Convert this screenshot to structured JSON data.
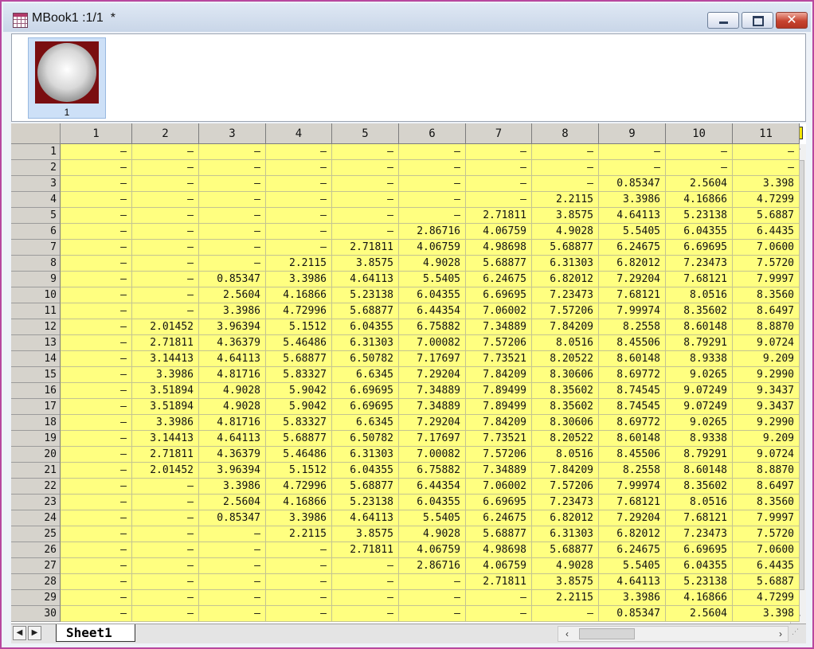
{
  "window": {
    "title": "MBook1 :1/1  *",
    "minimize_glyph": "",
    "maximize_glyph": "",
    "close_glyph": "✕"
  },
  "thumbnails": [
    {
      "label": "1",
      "image": "gray-sphere-on-dark-red"
    }
  ],
  "grid": {
    "columns": [
      "1",
      "2",
      "3",
      "4",
      "5",
      "6",
      "7",
      "8",
      "9",
      "10",
      "11"
    ],
    "rows": [
      {
        "label": "1",
        "cells": [
          "—",
          "—",
          "—",
          "—",
          "—",
          "—",
          "—",
          "—",
          "—",
          "—",
          "—"
        ]
      },
      {
        "label": "2",
        "cells": [
          "—",
          "—",
          "—",
          "—",
          "—",
          "—",
          "—",
          "—",
          "—",
          "—",
          "—"
        ]
      },
      {
        "label": "3",
        "cells": [
          "—",
          "—",
          "—",
          "—",
          "—",
          "—",
          "—",
          "—",
          "0.85347",
          "2.5604",
          "3.398"
        ]
      },
      {
        "label": "4",
        "cells": [
          "—",
          "—",
          "—",
          "—",
          "—",
          "—",
          "—",
          "2.2115",
          "3.3986",
          "4.16866",
          "4.7299"
        ]
      },
      {
        "label": "5",
        "cells": [
          "—",
          "—",
          "—",
          "—",
          "—",
          "—",
          "2.71811",
          "3.8575",
          "4.64113",
          "5.23138",
          "5.6887"
        ]
      },
      {
        "label": "6",
        "cells": [
          "—",
          "—",
          "—",
          "—",
          "—",
          "2.86716",
          "4.06759",
          "4.9028",
          "5.5405",
          "6.04355",
          "6.4435"
        ]
      },
      {
        "label": "7",
        "cells": [
          "—",
          "—",
          "—",
          "—",
          "2.71811",
          "4.06759",
          "4.98698",
          "5.68877",
          "6.24675",
          "6.69695",
          "7.0600"
        ]
      },
      {
        "label": "8",
        "cells": [
          "—",
          "—",
          "—",
          "2.2115",
          "3.8575",
          "4.9028",
          "5.68877",
          "6.31303",
          "6.82012",
          "7.23473",
          "7.5720"
        ]
      },
      {
        "label": "9",
        "cells": [
          "—",
          "—",
          "0.85347",
          "3.3986",
          "4.64113",
          "5.5405",
          "6.24675",
          "6.82012",
          "7.29204",
          "7.68121",
          "7.9997"
        ]
      },
      {
        "label": "10",
        "cells": [
          "—",
          "—",
          "2.5604",
          "4.16866",
          "5.23138",
          "6.04355",
          "6.69695",
          "7.23473",
          "7.68121",
          "8.0516",
          "8.3560"
        ]
      },
      {
        "label": "11",
        "cells": [
          "—",
          "—",
          "3.3986",
          "4.72996",
          "5.68877",
          "6.44354",
          "7.06002",
          "7.57206",
          "7.99974",
          "8.35602",
          "8.6497"
        ]
      },
      {
        "label": "12",
        "cells": [
          "—",
          "2.01452",
          "3.96394",
          "5.1512",
          "6.04355",
          "6.75882",
          "7.34889",
          "7.84209",
          "8.2558",
          "8.60148",
          "8.8870"
        ]
      },
      {
        "label": "13",
        "cells": [
          "—",
          "2.71811",
          "4.36379",
          "5.46486",
          "6.31303",
          "7.00082",
          "7.57206",
          "8.0516",
          "8.45506",
          "8.79291",
          "9.0724"
        ]
      },
      {
        "label": "14",
        "cells": [
          "—",
          "3.14413",
          "4.64113",
          "5.68877",
          "6.50782",
          "7.17697",
          "7.73521",
          "8.20522",
          "8.60148",
          "8.9338",
          "9.209"
        ]
      },
      {
        "label": "15",
        "cells": [
          "—",
          "3.3986",
          "4.81716",
          "5.83327",
          "6.6345",
          "7.29204",
          "7.84209",
          "8.30606",
          "8.69772",
          "9.0265",
          "9.2990"
        ]
      },
      {
        "label": "16",
        "cells": [
          "—",
          "3.51894",
          "4.9028",
          "5.9042",
          "6.69695",
          "7.34889",
          "7.89499",
          "8.35602",
          "8.74545",
          "9.07249",
          "9.3437"
        ]
      },
      {
        "label": "17",
        "cells": [
          "—",
          "3.51894",
          "4.9028",
          "5.9042",
          "6.69695",
          "7.34889",
          "7.89499",
          "8.35602",
          "8.74545",
          "9.07249",
          "9.3437"
        ]
      },
      {
        "label": "18",
        "cells": [
          "—",
          "3.3986",
          "4.81716",
          "5.83327",
          "6.6345",
          "7.29204",
          "7.84209",
          "8.30606",
          "8.69772",
          "9.0265",
          "9.2990"
        ]
      },
      {
        "label": "19",
        "cells": [
          "—",
          "3.14413",
          "4.64113",
          "5.68877",
          "6.50782",
          "7.17697",
          "7.73521",
          "8.20522",
          "8.60148",
          "8.9338",
          "9.209"
        ]
      },
      {
        "label": "20",
        "cells": [
          "—",
          "2.71811",
          "4.36379",
          "5.46486",
          "6.31303",
          "7.00082",
          "7.57206",
          "8.0516",
          "8.45506",
          "8.79291",
          "9.0724"
        ]
      },
      {
        "label": "21",
        "cells": [
          "—",
          "2.01452",
          "3.96394",
          "5.1512",
          "6.04355",
          "6.75882",
          "7.34889",
          "7.84209",
          "8.2558",
          "8.60148",
          "8.8870"
        ]
      },
      {
        "label": "22",
        "cells": [
          "—",
          "—",
          "3.3986",
          "4.72996",
          "5.68877",
          "6.44354",
          "7.06002",
          "7.57206",
          "7.99974",
          "8.35602",
          "8.6497"
        ]
      },
      {
        "label": "23",
        "cells": [
          "—",
          "—",
          "2.5604",
          "4.16866",
          "5.23138",
          "6.04355",
          "6.69695",
          "7.23473",
          "7.68121",
          "8.0516",
          "8.3560"
        ]
      },
      {
        "label": "24",
        "cells": [
          "—",
          "—",
          "0.85347",
          "3.3986",
          "4.64113",
          "5.5405",
          "6.24675",
          "6.82012",
          "7.29204",
          "7.68121",
          "7.9997"
        ]
      },
      {
        "label": "25",
        "cells": [
          "—",
          "—",
          "—",
          "2.2115",
          "3.8575",
          "4.9028",
          "5.68877",
          "6.31303",
          "6.82012",
          "7.23473",
          "7.5720"
        ]
      },
      {
        "label": "26",
        "cells": [
          "—",
          "—",
          "—",
          "—",
          "2.71811",
          "4.06759",
          "4.98698",
          "5.68877",
          "6.24675",
          "6.69695",
          "7.0600"
        ]
      },
      {
        "label": "27",
        "cells": [
          "—",
          "—",
          "—",
          "—",
          "—",
          "2.86716",
          "4.06759",
          "4.9028",
          "5.5405",
          "6.04355",
          "6.4435"
        ]
      },
      {
        "label": "28",
        "cells": [
          "—",
          "—",
          "—",
          "—",
          "—",
          "—",
          "2.71811",
          "3.8575",
          "4.64113",
          "5.23138",
          "5.6887"
        ]
      },
      {
        "label": "29",
        "cells": [
          "—",
          "—",
          "—",
          "—",
          "—",
          "—",
          "—",
          "2.2115",
          "3.3986",
          "4.16866",
          "4.7299"
        ]
      },
      {
        "label": "30",
        "cells": [
          "—",
          "—",
          "—",
          "—",
          "—",
          "—",
          "—",
          "—",
          "0.85347",
          "2.5604",
          "3.398"
        ]
      }
    ]
  },
  "sheets": [
    {
      "label": "Sheet1",
      "active": true
    }
  ],
  "colors": {
    "cell_fill": "#ffff80",
    "header_fill": "#d6d3cc",
    "window_border": "#b8479f"
  }
}
